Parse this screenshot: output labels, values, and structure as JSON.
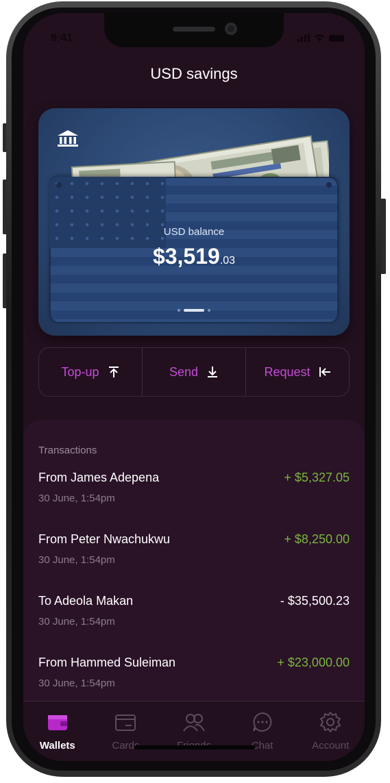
{
  "status": {
    "time": "9:41"
  },
  "page": {
    "title": "USD savings"
  },
  "wallet": {
    "balance_label": "USD balance",
    "balance_main": "$3,519",
    "balance_cents": ".03",
    "pages": 3,
    "active_page": 2
  },
  "actions": [
    {
      "label": "Top-up",
      "icon": "arrow-up-to-bar-icon"
    },
    {
      "label": "Send",
      "icon": "arrow-down-to-bar-icon"
    },
    {
      "label": "Request",
      "icon": "arrow-left-to-bar-icon"
    }
  ],
  "transactions": {
    "title": "Transactions",
    "items": [
      {
        "name": "From James Adepena",
        "date": "30 June, 1:54pm",
        "amount": "+ $5,327.05",
        "direction": "in"
      },
      {
        "name": "From Peter Nwachukwu",
        "date": "30 June, 1:54pm",
        "amount": "+ $8,250.00",
        "direction": "in"
      },
      {
        "name": "To Adeola Makan",
        "date": "30 June, 1:54pm",
        "amount": "- $35,500.23",
        "direction": "out"
      },
      {
        "name": "From Hammed Suleiman",
        "date": "30 June, 1:54pm",
        "amount": "+ $23,000.00",
        "direction": "in"
      }
    ]
  },
  "nav": {
    "items": [
      {
        "label": "Wallets",
        "icon": "wallet-icon",
        "active": true
      },
      {
        "label": "Cards",
        "icon": "card-icon",
        "active": false
      },
      {
        "label": "Friends",
        "icon": "friends-icon",
        "active": false
      },
      {
        "label": "Chat",
        "icon": "chat-icon",
        "active": false
      },
      {
        "label": "Account",
        "icon": "gear-icon",
        "active": false
      }
    ]
  },
  "colors": {
    "background": "#22101f",
    "panel": "#2a1227",
    "accent": "#c64bd8",
    "positive": "#79b73d",
    "wallet_blue": "#2b4772"
  }
}
